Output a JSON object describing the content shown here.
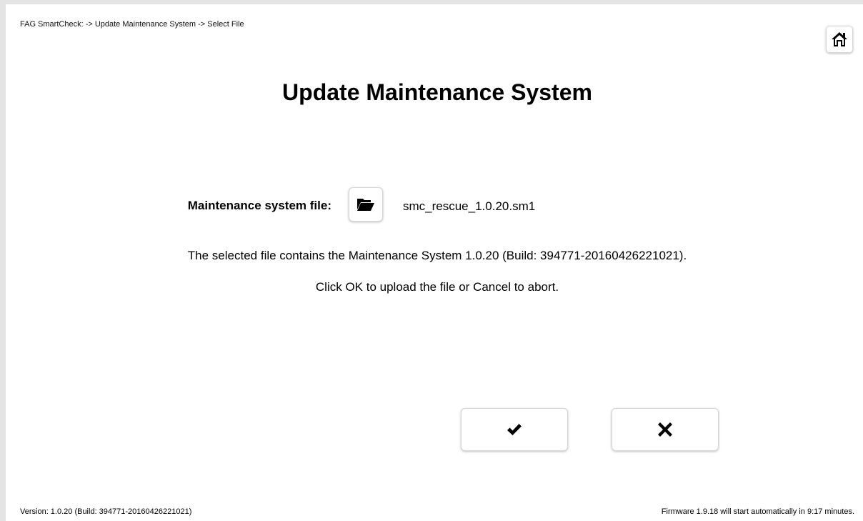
{
  "header": {
    "breadcrumb": "FAG SmartCheck: -> Update Maintenance System -> Select File",
    "home_icon": "home-icon"
  },
  "main": {
    "title": "Update Maintenance System",
    "file_label": "Maintenance system file:",
    "folder_icon": "folder-open-icon",
    "file_name": "smc_rescue_1.0.20.sm1",
    "info_text": "The selected file contains the Maintenance System 1.0.20 (Build: 394771-20160426221021).",
    "instruction_text": "Click OK to upload the file or Cancel to abort."
  },
  "actions": {
    "ok_icon": "checkmark-icon",
    "cancel_icon": "close-icon"
  },
  "footer": {
    "version": "Version: 1.0.20 (Build: 394771-20160426221021)",
    "firmware_notice": "Firmware 1.9.18 will start automatically in 9:17 minutes."
  }
}
